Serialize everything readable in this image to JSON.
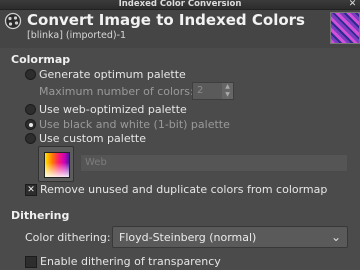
{
  "window": {
    "title": "Indexed Color Conversion",
    "close_glyph": "✕"
  },
  "header": {
    "title": "Convert Image to Indexed Colors",
    "subtitle": "[blinka] (imported)-1",
    "icon": "convert-indexed-icon"
  },
  "colormap": {
    "section_label": "Colormap",
    "options": [
      {
        "label": "Generate optimum palette",
        "selected": false,
        "enabled": true
      },
      {
        "label": "Use web-optimized palette",
        "selected": false,
        "enabled": true
      },
      {
        "label": "Use black and white (1-bit) palette",
        "selected": true,
        "enabled": false
      },
      {
        "label": "Use custom palette",
        "selected": false,
        "enabled": true
      }
    ],
    "max_colors_label": "Maximum number of colors:",
    "max_colors_value": "2",
    "custom_palette_name": "Web",
    "remove_unused_label": "Remove unused and duplicate colors from colormap",
    "remove_unused_checked": true
  },
  "dithering": {
    "section_label": "Dithering",
    "color_dithering_label": "Color dithering:",
    "color_dithering_value": "Floyd-Steinberg (normal)",
    "transparency_label": "Enable dithering of transparency",
    "transparency_checked": false
  }
}
